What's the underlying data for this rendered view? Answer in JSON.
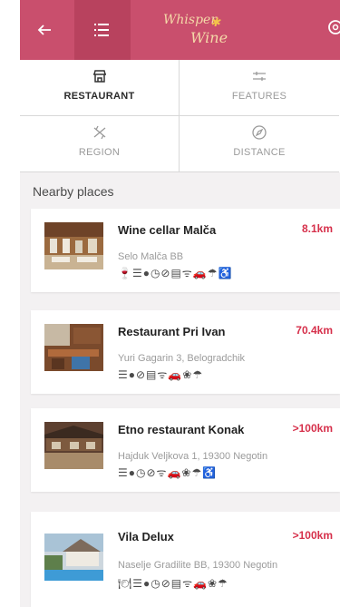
{
  "header": {
    "back_icon": "arrow-left-icon",
    "menu_icon": "list-icon",
    "logo_line1": "Whisper",
    "logo_line2": "Wine",
    "settings_icon": "gear-icon",
    "color": "#c94f6d",
    "menu_color": "#b8425e"
  },
  "filters": [
    {
      "label": "RESTAURANT",
      "icon": "restaurant-icon",
      "active": true
    },
    {
      "label": "FEATURES",
      "icon": "sliders-icon",
      "active": false
    },
    {
      "label": "REGION",
      "icon": "map-marker-icon",
      "active": false
    },
    {
      "label": "DISTANCE",
      "icon": "compass-icon",
      "active": false
    }
  ],
  "section_title": "Nearby places",
  "places": [
    {
      "name": "Wine cellar Malča",
      "distance": "8.1km",
      "address": "Selo Malča BB",
      "amenities": "🍷☰●◷⊘▤ᯤ🚗☂♿"
    },
    {
      "name": "Restaurant Pri Ivan",
      "distance": "70.4km",
      "address": "Yuri Gagarin 3, Belogradchik",
      "amenities": "☰●⊘▤ᯤ🚗❀☂"
    },
    {
      "name": "Etno restaurant Konak",
      "distance": ">100km",
      "address": "Hajduk Veljkova 1, 19300 Negotin",
      "amenities": "☰●◷⊘ᯤ🚗❀☂♿"
    },
    {
      "name": "Vila Delux",
      "distance": ">100km",
      "address": "Naselje Gradilite BB, 19300 Negotin",
      "amenities": "🍽☰●◷⊘▤ᯤ🚗❀☂"
    }
  ],
  "accent": "#d6304b"
}
